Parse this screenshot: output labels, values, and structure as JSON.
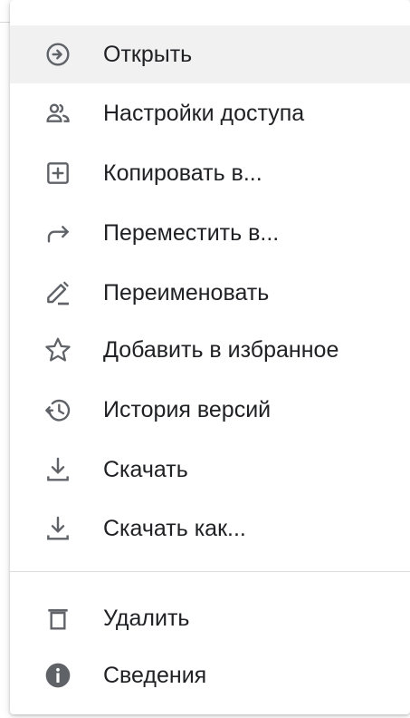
{
  "menu": {
    "items": [
      {
        "label": "Открыть",
        "icon": "open-arrow-icon"
      },
      {
        "label": "Настройки доступа",
        "icon": "share-people-icon"
      },
      {
        "label": "Копировать в...",
        "icon": "copy-plus-icon"
      },
      {
        "label": "Переместить в...",
        "icon": "move-arrow-icon"
      },
      {
        "label": "Переименовать",
        "icon": "rename-pencil-icon"
      },
      {
        "label": "Добавить в избранное",
        "icon": "star-icon"
      },
      {
        "label": "История версий",
        "icon": "version-history-icon"
      },
      {
        "label": "Скачать",
        "icon": "download-icon"
      },
      {
        "label": "Скачать как...",
        "icon": "download-as-icon"
      },
      {
        "label": "Удалить",
        "icon": "trash-icon"
      },
      {
        "label": "Сведения",
        "icon": "info-icon"
      }
    ]
  },
  "colors": {
    "icon": "#5f6368",
    "text": "#202124",
    "hover_background": "#f1f1f1",
    "divider": "#dadce0"
  }
}
